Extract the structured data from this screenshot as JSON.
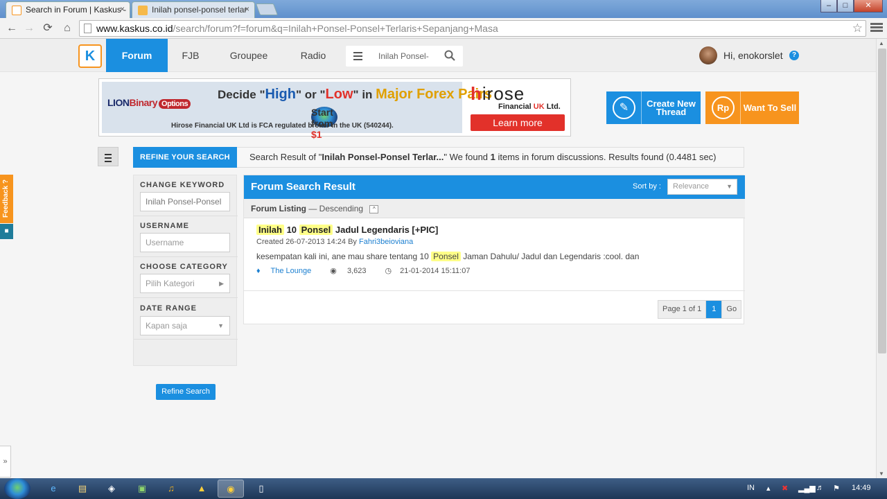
{
  "browser": {
    "tabs": [
      {
        "title": "Search in Forum | Kaskus -",
        "close": "×"
      },
      {
        "title": "Inilah ponsel-ponsel terlar",
        "close": "×"
      }
    ],
    "window_buttons": {
      "minimize": "‒",
      "maximize": "□",
      "close": "✕"
    },
    "url_host": "www.kaskus.co.id",
    "url_path": "/search/forum?f=forum&q=Inilah+Ponsel-Ponsel+Terlaris+Sepanjang+Masa",
    "icons": {
      "back": "←",
      "forward": "→",
      "reload": "⟳",
      "home": "⌂",
      "star": "☆"
    }
  },
  "header": {
    "logo_text": "K",
    "nav": [
      "Forum",
      "FJB",
      "Groupee",
      "Radio"
    ],
    "search_query": "Inilah Ponsel-",
    "greeting": "Hi, enokorslet",
    "help": "?"
  },
  "ad": {
    "brand_left": "LION",
    "brand_left_2": "Binary",
    "brand_left_badge": "Options",
    "headline_1": "Decide \"",
    "headline_high": "High",
    "headline_2": "\" or \"",
    "headline_low": "Low",
    "headline_3": "\" in ",
    "headline_major": "Major Forex Pairs",
    "start_text": "Start from ",
    "start_price": "$1",
    "fine_print": "Hirose Financial UK Ltd is FCA regulated broker in the UK (540244).",
    "brand_right_h": "h",
    "brand_right": "irose",
    "brand_right_sub_1": "Financial ",
    "brand_right_sub_uk": "UK",
    "brand_right_sub_2": " Ltd.",
    "learn_more": "Learn more"
  },
  "cta": {
    "create_thread": "Create New Thread",
    "create_icon": "✎",
    "want_to_sell": "Want To Sell",
    "sell_icon": "Rp"
  },
  "search": {
    "refine_tab": "REFINE YOUR SEARCH",
    "summary_prefix": "Search Result of \"",
    "summary_query": "Inilah Ponsel-Ponsel Terlar...",
    "summary_mid": "\" We found ",
    "summary_count": "1",
    "summary_suffix": " items in forum discussions. Results found (0.4481 sec)"
  },
  "sidebar": {
    "keyword_label": "CHANGE KEYWORD",
    "keyword_value": "Inilah Ponsel-Ponsel",
    "username_label": "USERNAME",
    "username_placeholder": "Username",
    "category_label": "CHOOSE CATEGORY",
    "category_placeholder": "Pilih Kategori",
    "date_label": "DATE RANGE",
    "date_value": "Kapan saja",
    "refine_button": "Refine Search"
  },
  "results": {
    "title": "Forum Search Result",
    "sort_label": "Sort by :",
    "sort_value": "Relevance",
    "listing_label": "Forum Listing",
    "listing_order": " — Descending",
    "collapse": "^",
    "thread": {
      "title_hl_1": "Inilah",
      "title_num": " 10 ",
      "title_hl_2": "Ponsel",
      "title_rest": " Jadul Legendaris [+PIC]",
      "created": "Created 26-07-2013 14:24 By ",
      "author": "Fahri3beioviana",
      "snippet_1": "kesempatan kali ini, ane mau share tentang 10 ",
      "snippet_hl": "Ponsel",
      "snippet_2": " Jaman Dahulu/ Jadul dan Legendaris :cool. dan",
      "category": "The Lounge",
      "views": "3,623",
      "last_post": "21-01-2014 15:11:07"
    },
    "pager": {
      "label": "Page 1 of 1",
      "current": "1",
      "go": "Go"
    }
  },
  "feedback": {
    "label": "Feedback ?"
  },
  "side_expand": "»",
  "taskbar": {
    "lang": "IN",
    "time": "14:49"
  },
  "colors": {
    "brand_blue": "#1b8fe0",
    "brand_orange": "#f7941e",
    "highlight": "#ffff88"
  }
}
